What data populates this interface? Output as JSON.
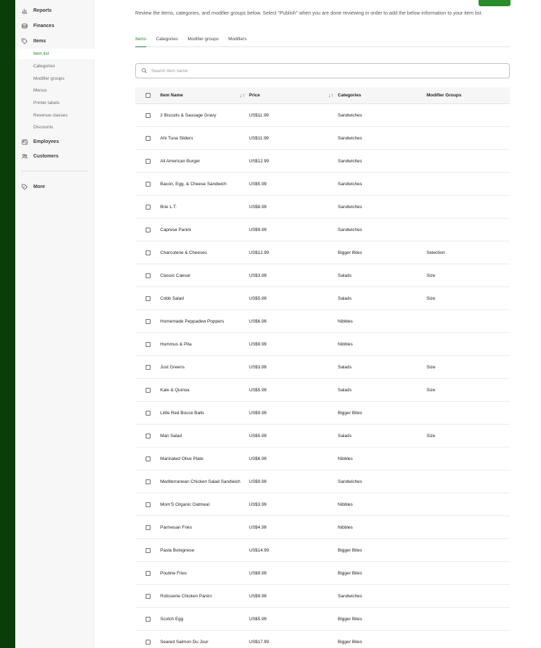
{
  "sidebar": {
    "nav": [
      {
        "label": "Reports",
        "icon": "reports-icon"
      },
      {
        "label": "Finances",
        "icon": "finances-icon"
      },
      {
        "label": "Items",
        "icon": "tag-icon"
      }
    ],
    "sub_items": [
      "Item list",
      "Categories",
      "Modifier groups",
      "Menus",
      "Printer labels",
      "Revenue classes",
      "Discounts"
    ],
    "active_sub": "Item list",
    "nav2": [
      {
        "label": "Employees",
        "icon": "employees-icon"
      },
      {
        "label": "Customers",
        "icon": "customers-icon"
      }
    ],
    "more": "More"
  },
  "main": {
    "description": "Review the items, categories, and modifier groups below. Select “Publish” when you are done reviewing in order to add the below information to your item list.",
    "tabs": [
      "Items",
      "Categories",
      "Modifier groups",
      "Modifiers"
    ],
    "active_tab": "Items",
    "search_placeholder": "Search item name"
  },
  "table": {
    "headers": {
      "name": "Item Name",
      "price": "Price",
      "categories": "Categories",
      "modifier_groups": "Modifier Groups"
    },
    "rows": [
      {
        "name": "2 Biscuits & Sausage Gravy",
        "price": "US$11.99",
        "category": "Sandwiches",
        "modifier": ""
      },
      {
        "name": "Ahi Tuna Sliders",
        "price": "US$11.99",
        "category": "Sandwiches",
        "modifier": ""
      },
      {
        "name": "All American Burger",
        "price": "US$12.99",
        "category": "Sandwiches",
        "modifier": ""
      },
      {
        "name": "Bacon, Egg, & Cheese Sandwich",
        "price": "US$5.99",
        "category": "Sandwiches",
        "modifier": ""
      },
      {
        "name": "Brie L.T.",
        "price": "US$8.99",
        "category": "Sandwiches",
        "modifier": ""
      },
      {
        "name": "Caprese Panini",
        "price": "US$9.99",
        "category": "Sandwiches",
        "modifier": ""
      },
      {
        "name": "Charcuterie & Cheeses",
        "price": "US$12.99",
        "category": "Bigger Bites",
        "modifier": "Selection"
      },
      {
        "name": "Classic Caesar",
        "price": "US$3.99",
        "category": "Salads",
        "modifier": "Size"
      },
      {
        "name": "Cobb Salad",
        "price": "US$5.99",
        "category": "Salads",
        "modifier": "Size"
      },
      {
        "name": "Homemade Peppadew Poppers",
        "price": "US$6.99",
        "category": "Nibbles",
        "modifier": ""
      },
      {
        "name": "Hummus & Pita",
        "price": "US$9.99",
        "category": "Nibbles",
        "modifier": ""
      },
      {
        "name": "Just Greens",
        "price": "US$3.99",
        "category": "Salads",
        "modifier": "Size"
      },
      {
        "name": "Kale & Quinoa",
        "price": "US$5.99",
        "category": "Salads",
        "modifier": "Size"
      },
      {
        "name": "Little Red Bocce Balls",
        "price": "US$9.99",
        "category": "Bigger Bites",
        "modifier": ""
      },
      {
        "name": "Man Salad",
        "price": "US$5.99",
        "category": "Salads",
        "modifier": "Size"
      },
      {
        "name": "Marinated Olive Plate",
        "price": "US$6.99",
        "category": "Nibbles",
        "modifier": ""
      },
      {
        "name": "Mediterranean Chicken Salad Sandwich",
        "price": "US$9.99",
        "category": "Sandwiches",
        "modifier": ""
      },
      {
        "name": "Mom'S Organic Oatmeal",
        "price": "US$3.99",
        "category": "Nibbles",
        "modifier": ""
      },
      {
        "name": "Parmesan Fries",
        "price": "US$4.99",
        "category": "Nibbles",
        "modifier": ""
      },
      {
        "name": "Pasta Bolognese",
        "price": "US$14.99",
        "category": "Bigger Bites",
        "modifier": ""
      },
      {
        "name": "Poutine Fries",
        "price": "US$9.99",
        "category": "Bigger Bites",
        "modifier": ""
      },
      {
        "name": "Rotisserie Chicken Panini",
        "price": "US$9.99",
        "category": "Sandwiches",
        "modifier": ""
      },
      {
        "name": "Scotch Egg",
        "price": "US$5.99",
        "category": "Bigger Bites",
        "modifier": ""
      },
      {
        "name": "Seared Salmon Du Jour",
        "price": "US$17.99",
        "category": "Bigger Bites",
        "modifier": ""
      }
    ]
  },
  "colors": {
    "accent": "#2a7d2a",
    "backdrop": "#0b3d0b"
  }
}
